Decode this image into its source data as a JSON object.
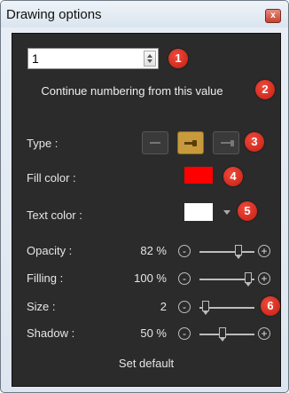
{
  "window": {
    "title": "Drawing options",
    "close_glyph": "x"
  },
  "numbering": {
    "value": "1",
    "hint": "Continue numbering from this value"
  },
  "type": {
    "label": "Type :",
    "options": [
      "line",
      "arrow",
      "arrow-right"
    ],
    "selected": "arrow"
  },
  "fill_color": {
    "label": "Fill color :",
    "color": "#ff0000"
  },
  "text_color": {
    "label": "Text color :",
    "color": "#ffffff"
  },
  "sliders": [
    {
      "label": "Opacity :",
      "value_text": "82 %",
      "fraction": 0.82
    },
    {
      "label": "Filling :",
      "value_text": "100 %",
      "fraction": 1.0
    },
    {
      "label": "Size :",
      "value_text": "2",
      "fraction": 0.05
    },
    {
      "label": "Shadow :",
      "value_text": "50 %",
      "fraction": 0.5
    }
  ],
  "set_default_label": "Set default",
  "callouts": [
    "1",
    "2",
    "3",
    "4",
    "5",
    "6"
  ],
  "colors": {
    "panel_bg": "#2b2b2b",
    "callout": "#d4271a",
    "active_type": "#c79a3b"
  }
}
